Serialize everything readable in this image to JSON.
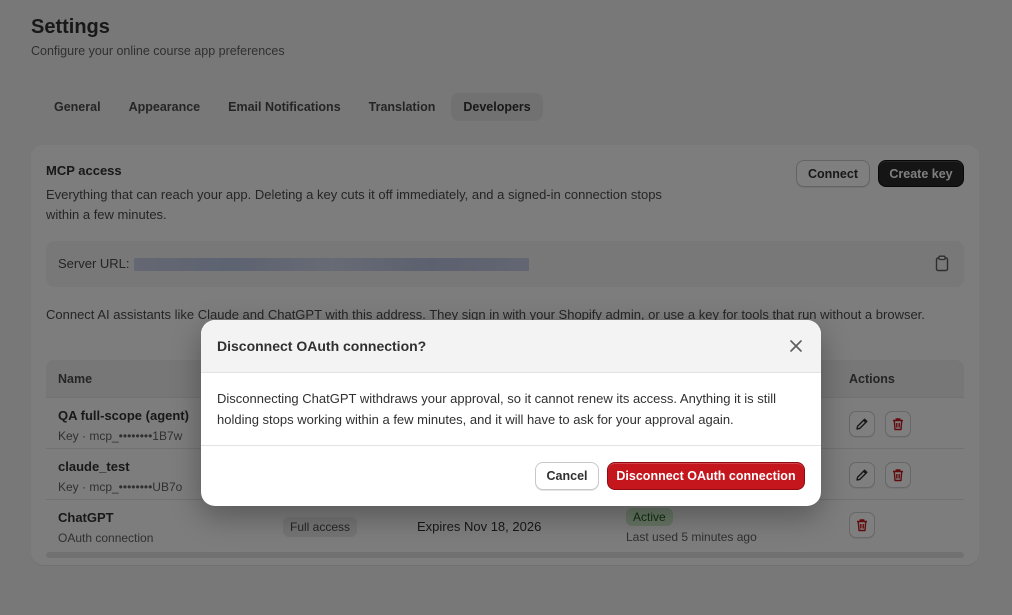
{
  "page": {
    "title": "Settings",
    "subtitle": "Configure your online course app preferences"
  },
  "tabs": [
    {
      "label": "General",
      "active": false
    },
    {
      "label": "Appearance",
      "active": false
    },
    {
      "label": "Email Notifications",
      "active": false
    },
    {
      "label": "Translation",
      "active": false
    },
    {
      "label": "Developers",
      "active": true
    }
  ],
  "mcp": {
    "title": "MCP access",
    "description": "Everything that can reach your app. Deleting a key cuts it off immediately, and a signed-in connection stops within a few minutes.",
    "connect_label": "Connect",
    "create_key_label": "Create key",
    "server_label": "Server URL:",
    "connect_note": "Connect AI assistants like Claude and ChatGPT with this address. They sign in with your Shopify admin, or use a key for tools that run without a browser."
  },
  "table": {
    "headers": {
      "name": "Name",
      "actions": "Actions"
    },
    "rows": [
      {
        "name": "QA full-scope (agent)",
        "sub": "Key · mcp_••••••••1B7w"
      },
      {
        "name": "claude_test",
        "sub": "Key · mcp_••••••••UB7o"
      },
      {
        "name": "ChatGPT",
        "sub": "OAuth connection",
        "scope": "Full access",
        "expires": "Expires Nov 18, 2026",
        "status": "Active",
        "last_used": "Last used 5 minutes ago"
      }
    ]
  },
  "modal": {
    "title": "Disconnect OAuth connection?",
    "body": "Disconnecting ChatGPT withdraws your approval, so it cannot renew its access. Anything it is still holding stops working within a few minutes, and it will have to ask for your approval again.",
    "cancel_label": "Cancel",
    "confirm_label": "Disconnect OAuth connection"
  },
  "colors": {
    "danger": "#c5161d",
    "primary_dark": "#2b2b2b",
    "active_badge": "#cdeac8",
    "delete_icon": "#c5161d"
  },
  "icons": [
    "clipboard-icon",
    "pencil-icon",
    "trash-icon",
    "close-icon"
  ]
}
